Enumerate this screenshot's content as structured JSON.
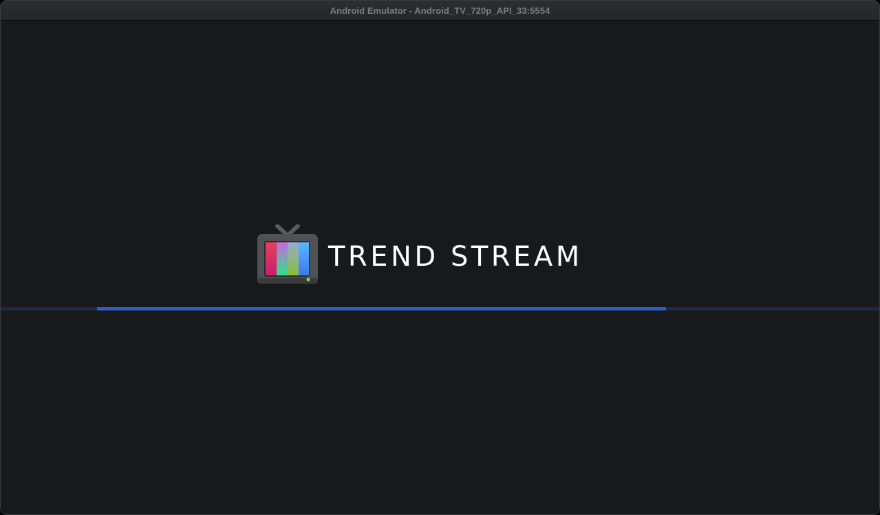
{
  "window": {
    "title": "Android Emulator - Android_TV_720p_API_33:5554"
  },
  "splash": {
    "logo_icon": "retro-tv-icon",
    "brand_name": "TREND STREAM"
  },
  "loading": {
    "progress_start": 0.11,
    "progress_end": 0.758
  },
  "colors": {
    "background": "#18191b",
    "progress_track": "#1d2a45",
    "progress_fill": "#2f5cc8",
    "brand_text": "#ffffff"
  }
}
